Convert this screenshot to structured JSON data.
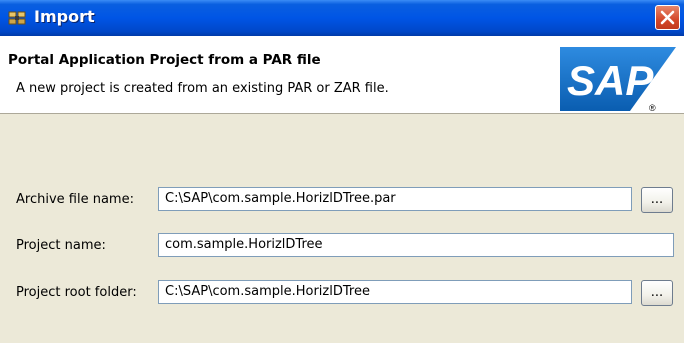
{
  "window": {
    "title": "Import",
    "icon": "import-wizard-icon",
    "close_icon": "close-icon"
  },
  "banner": {
    "title": "Portal Application Project from a PAR file",
    "description": "A new project is created from an existing PAR or ZAR file.",
    "logo_text": "SAP",
    "logo_mark": "®"
  },
  "form": {
    "archive_file": {
      "label": "Archive file name:",
      "value": "C:\\SAP\\com.sample.HorizlDTree.par",
      "browse_label": "..."
    },
    "project_name": {
      "label": "Project name:",
      "value": "com.sample.HorizlDTree"
    },
    "root_folder": {
      "label": "Project root folder:",
      "value": "C:\\SAP\\com.sample.HorizlDTree",
      "browse_label": "..."
    }
  },
  "colors": {
    "titlebar": "#0055E5",
    "dialog_bg": "#ECE9D8",
    "logo_blue": "#0A6CC4",
    "close_red": "#D4482A"
  }
}
